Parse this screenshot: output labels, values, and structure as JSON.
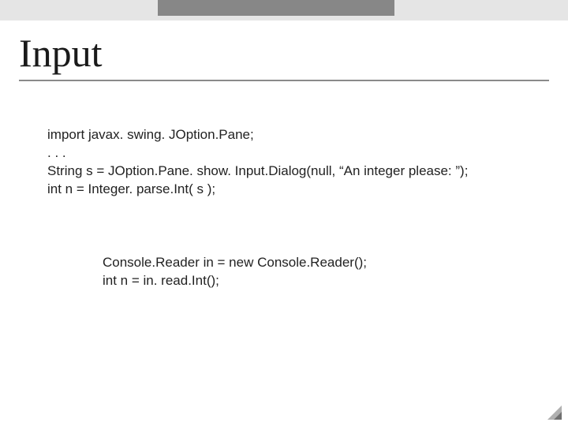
{
  "title": "Input",
  "block1": {
    "line1": "import javax. swing. JOption.Pane;",
    "line2": ". . .",
    "line3": "String s = JOption.Pane. show. Input.Dialog(null, “An integer please: ”);",
    "line4": "int n = Integer. parse.Int( s );"
  },
  "block2": {
    "line1": "Console.Reader in = new Console.Reader();",
    "line2": "int n = in. read.Int();"
  }
}
